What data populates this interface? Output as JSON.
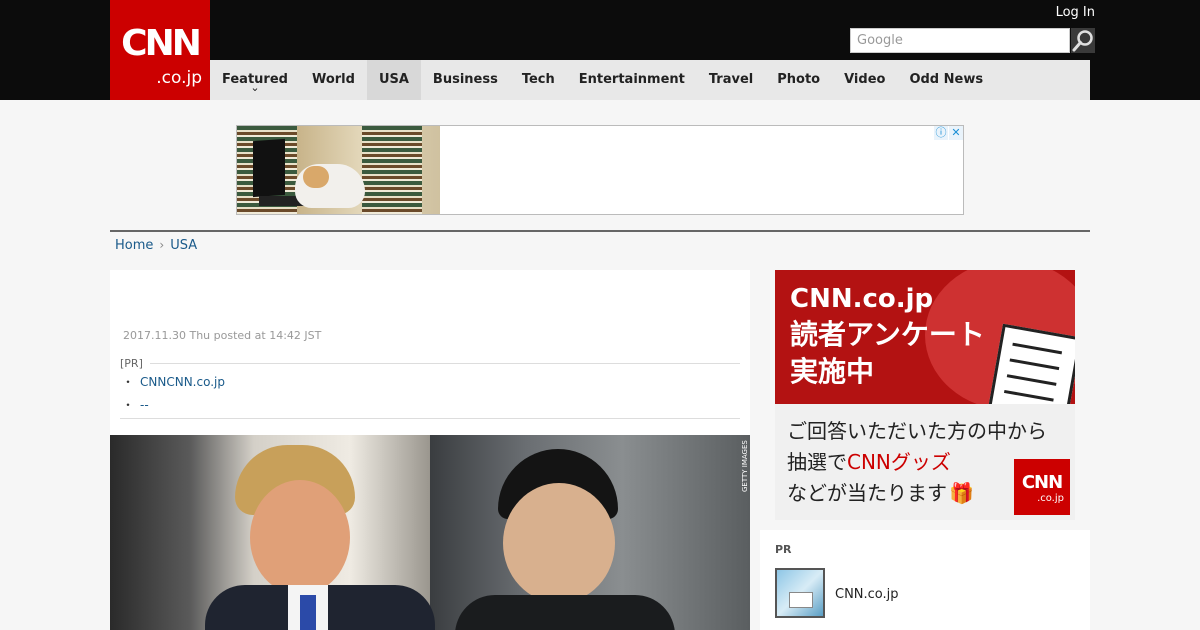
{
  "header": {
    "logo_main": "CNN",
    "logo_sub": ".co.jp",
    "login_label": "Log In",
    "search_placeholder": "Google"
  },
  "nav": {
    "items": [
      {
        "label": "Featured",
        "has_dropdown": true,
        "active": false
      },
      {
        "label": "World",
        "active": false
      },
      {
        "label": "USA",
        "active": true
      },
      {
        "label": "Business",
        "active": false
      },
      {
        "label": "Tech",
        "active": false
      },
      {
        "label": "Entertainment",
        "active": false
      },
      {
        "label": "Travel",
        "active": false
      },
      {
        "label": "Photo",
        "active": false
      },
      {
        "label": "Video",
        "active": false
      },
      {
        "label": "Odd News",
        "active": false
      }
    ],
    "dropdown_glyph": "⌄"
  },
  "ad": {
    "info_icon": "ⓘ",
    "close_icon": "✕"
  },
  "breadcrumb": {
    "home": "Home",
    "separator": "›",
    "current": "USA"
  },
  "article": {
    "posted": "2017.11.30 Thu posted at 14:42 JST",
    "pr_label": "[PR]",
    "pr_links": [
      {
        "bullet": "・",
        "text": "CNNCNN.co.jp"
      },
      {
        "bullet": "・",
        "text": "--"
      }
    ],
    "photo_credit": "GETTY IMAGES"
  },
  "promo": {
    "title_line1": "CNN.co.jp",
    "title_line2": "読者アンケート",
    "title_line3": "実施中",
    "body_line1": "ご回答いただいた方の中から",
    "body_line2_pre": "抽選で",
    "body_line2_red": "CNNグッズ",
    "body_line3": "などが当たります",
    "gift_icon": "🎁",
    "logo_main": "CNN",
    "logo_sub": ".co.jp"
  },
  "pr_box": {
    "label": "PR",
    "item_text": "CNN.co.jp"
  },
  "colors": {
    "brand_red": "#cc0000",
    "header_bg": "#0c0c0c",
    "nav_bg": "#e8e8e8",
    "link": "#1a5a8a"
  }
}
